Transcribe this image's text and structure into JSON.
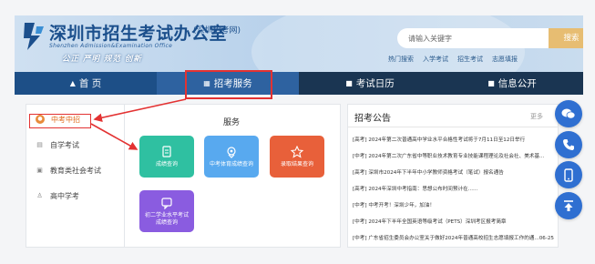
{
  "header": {
    "site_name": "深圳市招生考试办公室",
    "site_sub": "(深圳招考网)",
    "site_en": "Shenzhen Admission&Examination Office",
    "slogan": "公正 严明 规范 创新",
    "search_placeholder": "请输入关键字",
    "search_button": "搜索",
    "quick_links": [
      "热门搜索",
      "入学考试",
      "招生考试",
      "志愿填报"
    ]
  },
  "nav": {
    "items": [
      {
        "label": "首 页",
        "icon": "home-icon"
      },
      {
        "label": "招考服务",
        "icon": "grid-icon"
      },
      {
        "label": "考试日历",
        "icon": "calendar-icon"
      },
      {
        "label": "信息公开",
        "icon": "info-icon"
      }
    ]
  },
  "sidebar": {
    "items": [
      {
        "label": "中考中招",
        "icon": "school-icon"
      },
      {
        "label": "自学考试",
        "icon": "book-icon"
      },
      {
        "label": "教育类社会考试",
        "icon": "exam-icon"
      },
      {
        "label": "高中学考",
        "icon": "user-icon"
      }
    ]
  },
  "services": {
    "title": "服务",
    "cards": [
      {
        "label": "成绩查询",
        "color": "#2fc0a1",
        "icon": "document-icon"
      },
      {
        "label": "中考体育成绩查询",
        "color": "#58a9ef",
        "icon": "location-icon"
      },
      {
        "label": "录取结果查询",
        "color": "#e8603a",
        "icon": "star-icon"
      },
      {
        "label": "初二学业水平考试\n成绩查询",
        "color": "#8a5ce0",
        "icon": "chat-icon"
      }
    ]
  },
  "announcements": {
    "title": "招考公告",
    "more": "更多",
    "items": [
      "[高考] 2024年第二次普通高中学业水平合格性考试将于7月11日至12日举行",
      "[中考] 2024年第二次广东省中等职业技术教育专业技能课程理论及社会社、美术基...",
      "[高考] 深圳市2024年下半年中小学教师资格考试（笔试）报名通告",
      "[高考] 2024年深圳中考指南：思想公布时间预计在......",
      "[中考] 中考开考！深圳少年，加油！",
      "[中考] 2024年下半年全国英语等级考试（PETS）深圳考区报考简章",
      "[中考] 广东省招生委员会办公室关于做好2024年普通高校招生志愿填报工作的通...06-25"
    ]
  },
  "float_buttons": [
    {
      "icon": "wechat-icon"
    },
    {
      "icon": "phone-icon"
    },
    {
      "icon": "mobile-icon"
    },
    {
      "icon": "back-to-top-icon"
    }
  ]
}
